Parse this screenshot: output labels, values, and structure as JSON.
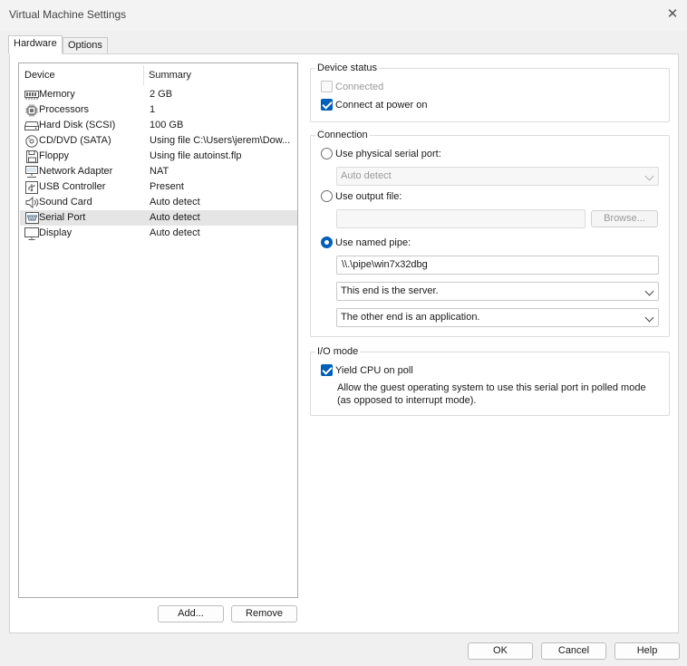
{
  "window": {
    "title": "Virtual Machine Settings"
  },
  "tabs": [
    {
      "label": "Hardware"
    },
    {
      "label": "Options"
    }
  ],
  "device_list": {
    "headers": {
      "device": "Device",
      "summary": "Summary"
    },
    "items": [
      {
        "name": "Memory",
        "summary": "2 GB",
        "icon": "memory-icon"
      },
      {
        "name": "Processors",
        "summary": "1",
        "icon": "processor-icon"
      },
      {
        "name": "Hard Disk (SCSI)",
        "summary": "100 GB",
        "icon": "hard-disk-icon"
      },
      {
        "name": "CD/DVD (SATA)",
        "summary": "Using file C:\\Users\\jerem\\Dow...",
        "icon": "cd-dvd-icon"
      },
      {
        "name": "Floppy",
        "summary": "Using file autoinst.flp",
        "icon": "floppy-icon"
      },
      {
        "name": "Network Adapter",
        "summary": "NAT",
        "icon": "network-adapter-icon"
      },
      {
        "name": "USB Controller",
        "summary": "Present",
        "icon": "usb-icon"
      },
      {
        "name": "Sound Card",
        "summary": "Auto detect",
        "icon": "speaker-icon"
      },
      {
        "name": "Serial Port",
        "summary": "Auto detect",
        "icon": "serial-port-icon",
        "selected": true
      },
      {
        "name": "Display",
        "summary": "Auto detect",
        "icon": "display-icon"
      }
    ]
  },
  "list_buttons": {
    "add": "Add...",
    "remove": "Remove"
  },
  "device_status": {
    "title": "Device status",
    "connected": {
      "label": "Connected",
      "checked": false,
      "disabled": true
    },
    "connect_at_power_on": {
      "label": "Connect at power on",
      "checked": true
    }
  },
  "connection": {
    "title": "Connection",
    "physical": {
      "label": "Use physical serial port:",
      "selected": false,
      "dropdown_value": "Auto detect"
    },
    "output_file": {
      "label": "Use output file:",
      "selected": false,
      "value": "",
      "browse_label": "Browse..."
    },
    "named_pipe": {
      "label": "Use named pipe:",
      "selected": true,
      "pipe_name": "\\\\.\\pipe\\win7x32dbg",
      "end_select": "This end is the server.",
      "other_end_select": "The other end is an application."
    }
  },
  "io_mode": {
    "title": "I/O mode",
    "yield_cpu": {
      "label": "Yield CPU on poll",
      "checked": true
    },
    "description": "Allow the guest operating system to use this serial port in polled mode (as opposed to interrupt mode)."
  },
  "footer": {
    "ok": "OK",
    "cancel": "Cancel",
    "help": "Help"
  },
  "colors": {
    "accent": "#005fb8",
    "selected_row": "#e5e5e5"
  }
}
